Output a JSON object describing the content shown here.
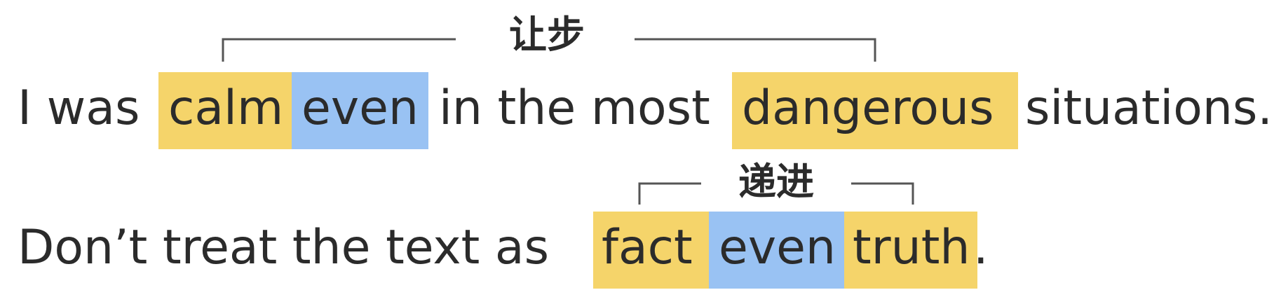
{
  "sentence1": {
    "words": [
      "I was",
      "calm",
      "even",
      "in the most",
      "dangerous",
      "situations."
    ],
    "label": "让步"
  },
  "sentence2": {
    "words": [
      "Don’t treat the text as",
      "fact",
      "even",
      "truth",
      "."
    ],
    "label": "递进"
  },
  "colors": {
    "yellow_highlight": "#f5d46a",
    "blue_highlight": "#99c2f3",
    "text": "#2b2b2b"
  }
}
